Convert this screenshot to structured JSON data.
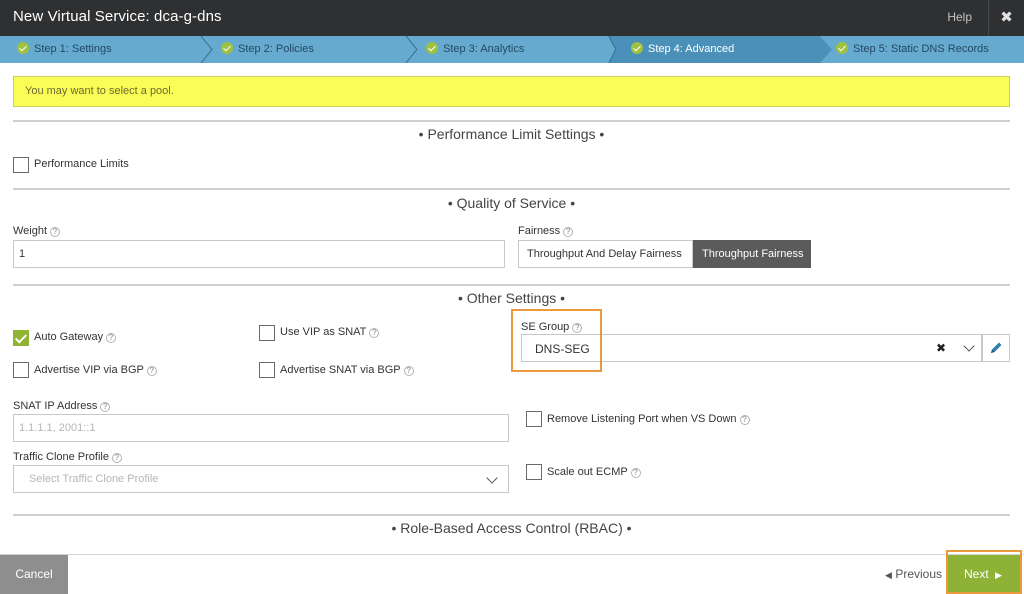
{
  "window": {
    "title": "New Virtual Service: dca-g-dns",
    "help": "Help",
    "close": "✖"
  },
  "steps": [
    {
      "label": "Step 1: Settings"
    },
    {
      "label": "Step 2: Policies"
    },
    {
      "label": "Step 3: Analytics"
    },
    {
      "label": "Step 4: Advanced"
    },
    {
      "label": "Step 5: Static DNS Records"
    }
  ],
  "warning": "You may want to select a pool.",
  "perf": {
    "title": "• Performance Limit Settings •",
    "checkbox": "Performance Limits"
  },
  "qos": {
    "title": "• Quality of Service •",
    "weight_label": "Weight",
    "weight_value": "1",
    "fairness_label": "Fairness",
    "fairness_options": [
      "Throughput And Delay Fairness",
      "Throughput Fairness"
    ]
  },
  "other": {
    "title": "• Other Settings •",
    "auto_gateway": "Auto Gateway",
    "use_vip_snat": "Use VIP as SNAT",
    "advertise_vip": "Advertise VIP via BGP",
    "advertise_snat": "Advertise SNAT via BGP",
    "se_group_label": "SE Group",
    "se_group_value": "DNS-SEG",
    "snat_label": "SNAT IP Address",
    "snat_placeholder": "1.1.1.1, 2001::1",
    "remove_port": "Remove Listening Port when VS Down",
    "clone_label": "Traffic Clone Profile",
    "clone_placeholder": "Select Traffic Clone Profile",
    "scale_ecmp": "Scale out ECMP"
  },
  "rbac": {
    "title": "• Role-Based Access Control (RBAC) •"
  },
  "footer": {
    "cancel": "Cancel",
    "previous": "Previous",
    "next": "Next"
  },
  "colors": {
    "accent": "#8db236",
    "highlight": "#e89a3c",
    "warning": "#fbfd57",
    "steps": "#66aacf"
  },
  "icons": [
    "close-icon",
    "check-circle-icon",
    "help-icon",
    "clear-icon",
    "chevron-down-icon",
    "pencil-icon",
    "caret-left-icon",
    "caret-right-icon"
  ]
}
